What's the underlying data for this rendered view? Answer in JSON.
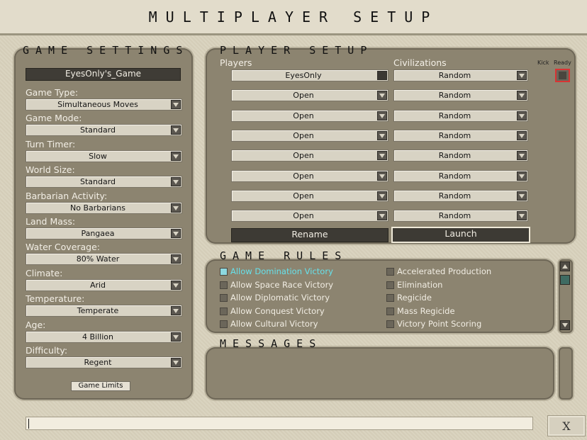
{
  "window": {
    "title": "MULTIPLAYER SETUP"
  },
  "game_settings": {
    "title": "GAME SETTINGS",
    "game_name": "EyesOnly's_Game",
    "fields": [
      {
        "label": "Game Type:",
        "value": "Simultaneous Moves"
      },
      {
        "label": "Game Mode:",
        "value": "Standard"
      },
      {
        "label": "Turn Timer:",
        "value": "Slow"
      },
      {
        "label": "World Size:",
        "value": "Standard"
      },
      {
        "label": "Barbarian Activity:",
        "value": "No Barbarians"
      },
      {
        "label": "Land Mass:",
        "value": "Pangaea"
      },
      {
        "label": "Water Coverage:",
        "value": "80% Water"
      },
      {
        "label": "Climate:",
        "value": "Arid"
      },
      {
        "label": "Temperature:",
        "value": "Temperate"
      },
      {
        "label": "Age:",
        "value": "4 Billion"
      },
      {
        "label": "Difficulty:",
        "value": "Regent"
      }
    ],
    "game_limits_label": "Game Limits"
  },
  "player_setup": {
    "title": "PLAYER SETUP",
    "players_header": "Players",
    "civs_header": "Civilizations",
    "kick_header": "Kick",
    "ready_header": "Ready",
    "rows": [
      {
        "player": "EyesOnly",
        "civ": "Random"
      },
      {
        "player": "Open",
        "civ": "Random"
      },
      {
        "player": "Open",
        "civ": "Random"
      },
      {
        "player": "Open",
        "civ": "Random"
      },
      {
        "player": "Open",
        "civ": "Random"
      },
      {
        "player": "Open",
        "civ": "Random"
      },
      {
        "player": "Open",
        "civ": "Random"
      },
      {
        "player": "Open",
        "civ": "Random"
      }
    ],
    "rename_label": "Rename",
    "launch_label": "Launch"
  },
  "game_rules": {
    "title": "GAME RULES",
    "left": [
      {
        "label": "Allow Domination Victory",
        "active": true
      },
      {
        "label": "Allow Space Race Victory"
      },
      {
        "label": "Allow Diplomatic Victory"
      },
      {
        "label": "Allow Conquest Victory"
      },
      {
        "label": "Allow Cultural Victory"
      }
    ],
    "right": [
      {
        "label": "Accelerated Production"
      },
      {
        "label": "Elimination"
      },
      {
        "label": "Regicide"
      },
      {
        "label": "Mass Regicide"
      },
      {
        "label": "Victory Point Scoring"
      }
    ]
  },
  "messages": {
    "title": "MESSAGES"
  },
  "chat": {
    "close_label": "X"
  },
  "colors": {
    "accent": "#66e0ea",
    "panel": "#8c8470",
    "ready_border": "#d93333"
  }
}
